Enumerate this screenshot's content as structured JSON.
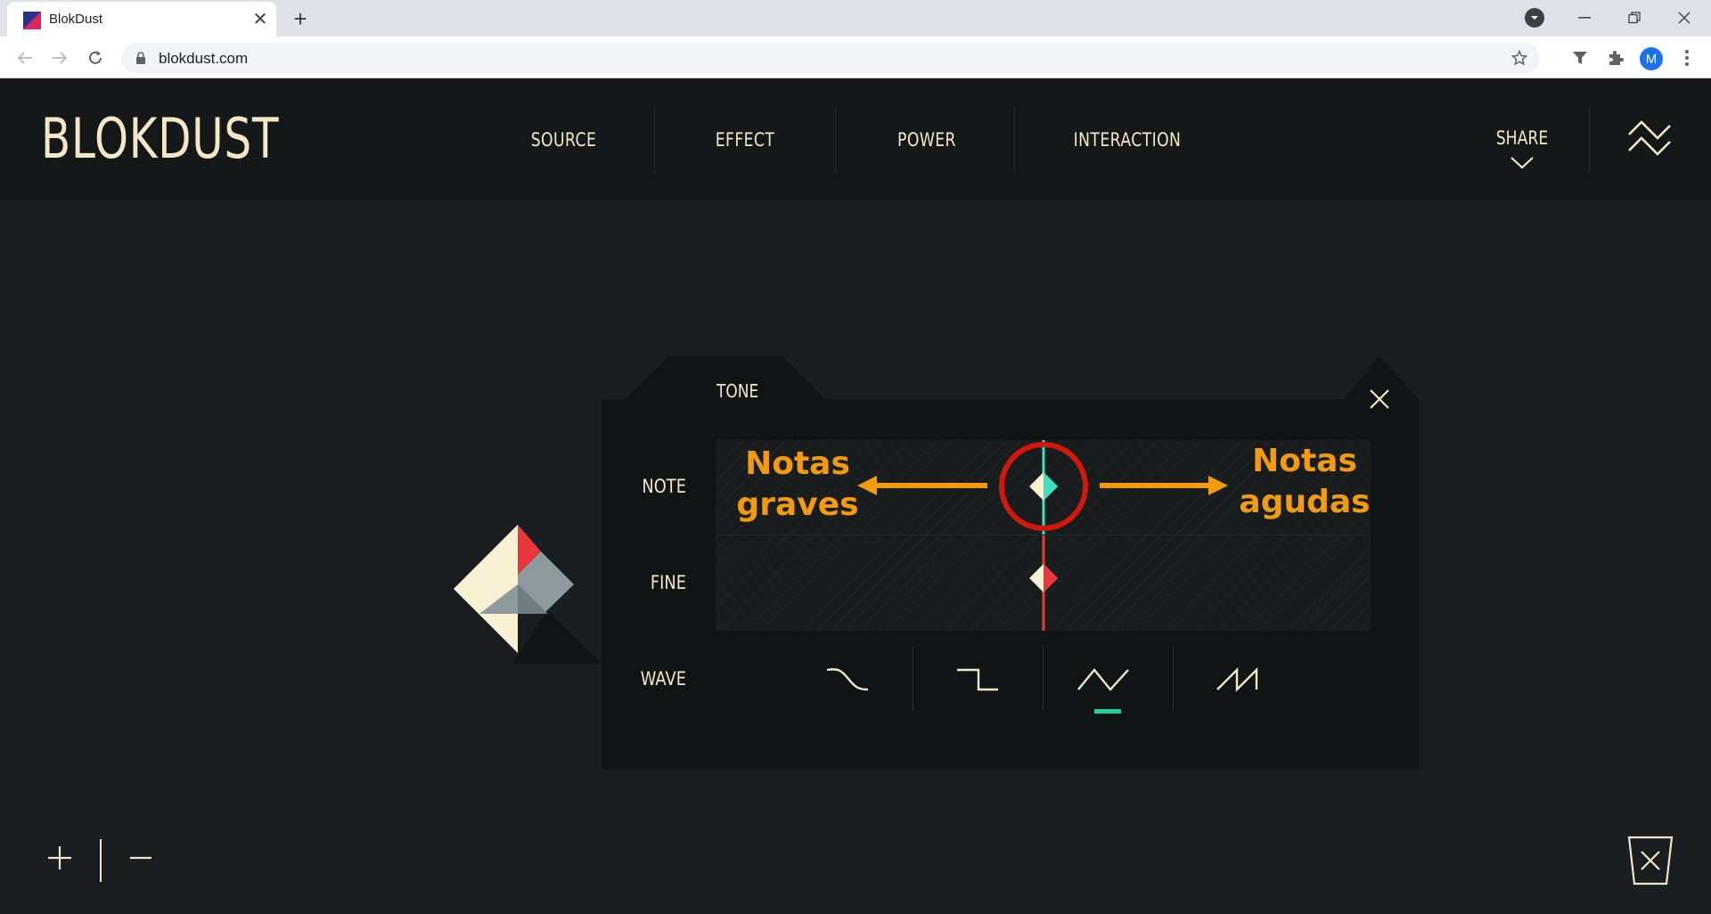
{
  "browser": {
    "tab_title": "BlokDust",
    "url": "blokdust.com",
    "avatar_letter": "M"
  },
  "app": {
    "logo": "BLOKDUST",
    "menu": [
      {
        "label": "SOURCE"
      },
      {
        "label": "EFFECT"
      },
      {
        "label": "POWER"
      },
      {
        "label": "INTERACTION"
      }
    ],
    "share_label": "SHARE"
  },
  "panel": {
    "title": "TONE",
    "rows": {
      "note": "NOTE",
      "fine": "FINE",
      "wave": "WAVE"
    },
    "waves": [
      {
        "name": "sine-wave-icon"
      },
      {
        "name": "square-wave-icon"
      },
      {
        "name": "triangle-wave-icon",
        "active": true
      },
      {
        "name": "sawtooth-wave-icon"
      }
    ],
    "note_value": 0.5,
    "fine_value": 0.5
  },
  "annotations": {
    "left_line1": "Notas",
    "left_line2": "graves",
    "right_line1": "Notas",
    "right_line2": "agudas"
  },
  "colors": {
    "accent_teal": "#3ee0c0",
    "accent_red": "#e8383d",
    "cream": "#f3e7c8",
    "annotation_orange": "#f29a10",
    "highlight_circle": "#d0190c",
    "active_wave": "#1fd19b"
  }
}
